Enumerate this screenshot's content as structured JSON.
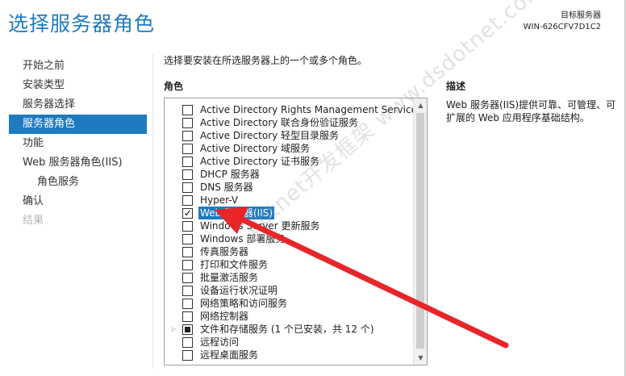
{
  "header": {
    "title": "选择服务器角色",
    "target_label": "目标服务器",
    "target_name": "WIN-626CFV7D1C2"
  },
  "nav": [
    {
      "label": "开始之前",
      "state": "normal"
    },
    {
      "label": "安装类型",
      "state": "normal"
    },
    {
      "label": "服务器选择",
      "state": "normal"
    },
    {
      "label": "服务器角色",
      "state": "active"
    },
    {
      "label": "功能",
      "state": "normal"
    },
    {
      "label": "Web 服务器角色(IIS)",
      "state": "normal"
    },
    {
      "label": "角色服务",
      "state": "sub"
    },
    {
      "label": "确认",
      "state": "normal"
    },
    {
      "label": "结果",
      "state": "disabled"
    }
  ],
  "main": {
    "instruction": "选择要安装在所选服务器上的一个或多个角色。",
    "roles_heading": "角色",
    "description_heading": "描述",
    "description_text": "Web 服务器(IIS)提供可靠、可管理、可扩展的 Web 应用程序基础结构。"
  },
  "roles": [
    {
      "label": "Active Directory Rights Management Services",
      "checked": false
    },
    {
      "label": "Active Directory 联合身份验证服务",
      "checked": false
    },
    {
      "label": "Active Directory 轻型目录服务",
      "checked": false
    },
    {
      "label": "Active Directory 域服务",
      "checked": false
    },
    {
      "label": "Active Directory 证书服务",
      "checked": false
    },
    {
      "label": "DHCP 服务器",
      "checked": false
    },
    {
      "label": "DNS 服务器",
      "checked": false
    },
    {
      "label": "Hyper-V",
      "checked": false
    },
    {
      "label": "Web 服务器(IIS)",
      "checked": true,
      "selected": true
    },
    {
      "label": "Windows Server 更新服务",
      "checked": false
    },
    {
      "label": "Windows 部署服务",
      "checked": false
    },
    {
      "label": "传真服务器",
      "checked": false
    },
    {
      "label": "打印和文件服务",
      "checked": false
    },
    {
      "label": "批量激活服务",
      "checked": false
    },
    {
      "label": "设备运行状况证明",
      "checked": false
    },
    {
      "label": "网络策略和访问服务",
      "checked": false
    },
    {
      "label": "网络控制器",
      "checked": false
    },
    {
      "label": "文件和存储服务 (1 个已安装，共 12 个)",
      "checked": "partial",
      "expandable": true
    },
    {
      "label": "远程访问",
      "checked": false
    },
    {
      "label": "远程桌面服务",
      "checked": false
    }
  ],
  "icons": {
    "expander": "triangle-right-icon",
    "check": "checkmark-icon",
    "scroll_up": "chevron-up-icon",
    "scroll_down": "chevron-down-icon"
  },
  "watermark": "dotnet开发框架 www.dsdotnet.com",
  "colors": {
    "accent": "#1f7bc0",
    "annotation_arrow": "#e8262a"
  }
}
